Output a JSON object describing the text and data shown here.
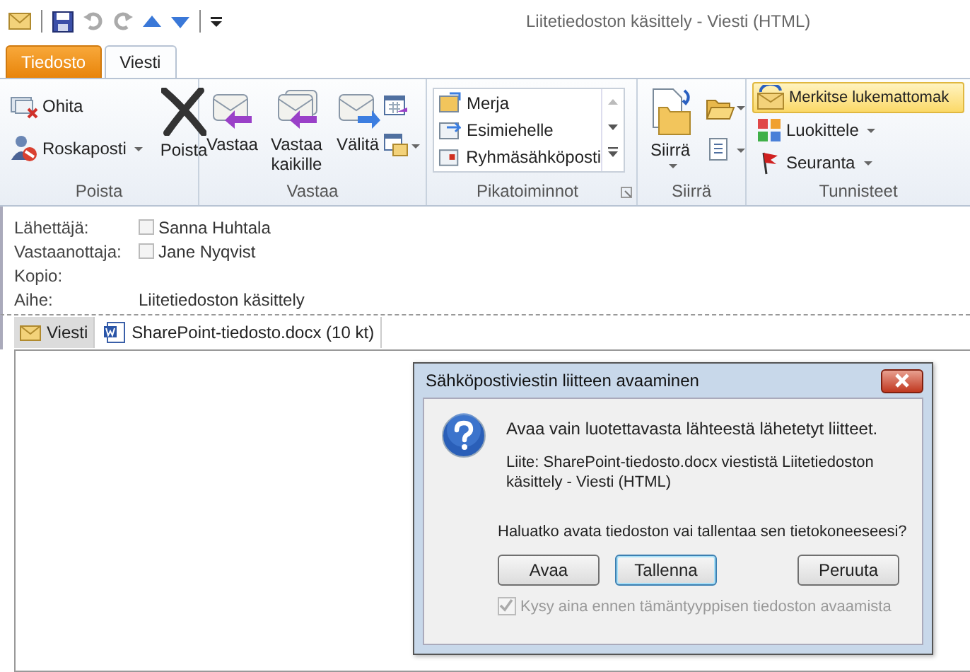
{
  "window": {
    "title": "Liitetiedoston käsittely  -  Viesti (HTML)"
  },
  "tabs": [
    {
      "label": "Tiedosto",
      "kind": "file",
      "selected": false
    },
    {
      "label": "Viesti",
      "kind": "normal",
      "selected": true
    }
  ],
  "ribbon": {
    "delete": {
      "label": "Poista",
      "ignore": "Ohita",
      "junk": "Roskaposti",
      "delete": "Poista"
    },
    "respond": {
      "label": "Vastaa",
      "reply": "Vastaa",
      "reply_all": "Vastaa kaikille",
      "forward": "Välitä"
    },
    "quick_steps": {
      "label": "Pikatoiminnot",
      "items": [
        "Merja",
        "Esimiehelle",
        "Ryhmäsähköposti"
      ]
    },
    "move": {
      "label": "Siirrä",
      "move": "Siirrä"
    },
    "tags": {
      "label": "Tunnisteet",
      "mark_unread": "Merkitse lukemattomak",
      "categorize": "Luokittele",
      "follow_up": "Seuranta"
    }
  },
  "header": [
    {
      "label": "Lähettäjä:",
      "kind": "person",
      "value": "Sanna Huhtala",
      "checked": false
    },
    {
      "label": "Vastaanottaja:",
      "kind": "person",
      "value": "Jane Nyqvist",
      "checked": false
    },
    {
      "label": "Kopio:",
      "kind": "text"
    },
    {
      "label": "Aihe:",
      "kind": "text",
      "value": "Liitetiedoston käsittely"
    }
  ],
  "attachments": [
    {
      "label": "Viesti",
      "kind": "message",
      "selected": true
    },
    {
      "label": "SharePoint-tiedosto.docx (10 kt)",
      "kind": "file",
      "selected": false
    }
  ],
  "dialog": {
    "title": "Sähköpostiviestin liitteen avaaminen",
    "message": "Avaa vain luotettavasta lähteestä lähetetyt liitteet.",
    "detail": "Liite: SharePoint-tiedosto.docx viestistä Liitetiedoston käsittely - Viesti (HTML)",
    "question": "Haluatko avata tiedoston vai tallentaa sen tietokoneeseesi?",
    "buttons": [
      {
        "label": "Avaa",
        "default": false
      },
      {
        "label": "Tallenna",
        "default": true
      },
      {
        "label": "Peruuta",
        "default": false
      }
    ],
    "checkbox": {
      "label": "Kysy aina ennen tämäntyyppisen tiedoston avaamista",
      "checked": true,
      "disabled": true
    }
  }
}
